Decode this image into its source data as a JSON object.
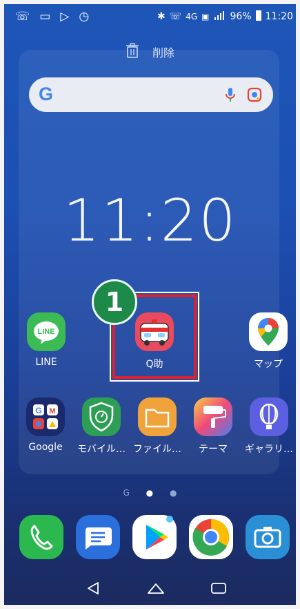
{
  "status_bar": {
    "network": "4G",
    "battery": "96%",
    "time": "11:20"
  },
  "delete_label": "削除",
  "clock": "11:20",
  "step_badge": "1",
  "apps_row1": [
    {
      "label": "LINE",
      "icon": "line-icon",
      "color": "#3cba54"
    },
    {
      "label": "Q助",
      "icon": "q-suke-ambulance-icon",
      "color": "#e84a5f"
    },
    {
      "label": "マップ",
      "icon": "maps-icon",
      "color": "#ffffff"
    }
  ],
  "apps_row2": [
    {
      "label": "Google",
      "icon": "google-folder-icon",
      "color": "#1a2a6c"
    },
    {
      "label": "モバイル…",
      "icon": "mobile-security-icon",
      "color": "#2e9e57"
    },
    {
      "label": "ファイル…",
      "icon": "files-icon",
      "color": "#f0a33a"
    },
    {
      "label": "テーマ",
      "icon": "theme-icon",
      "color": "#f04a7a"
    },
    {
      "label": "ギャラリ…",
      "icon": "gallery-icon",
      "color": "#5b5fe0"
    }
  ],
  "dock": [
    {
      "icon": "phone-icon",
      "color": "#2bb84f"
    },
    {
      "icon": "messages-icon",
      "color": "#2a6fdb"
    },
    {
      "icon": "play-store-icon",
      "color": "#ffffff"
    },
    {
      "icon": "chrome-icon",
      "color": "#ffffff"
    },
    {
      "icon": "camera-icon",
      "color": "#2a8fd4"
    }
  ],
  "page_indicator": {
    "google_dot": "G"
  },
  "highlight_color": "#e0202a",
  "badge_color": "#1d8a4a"
}
